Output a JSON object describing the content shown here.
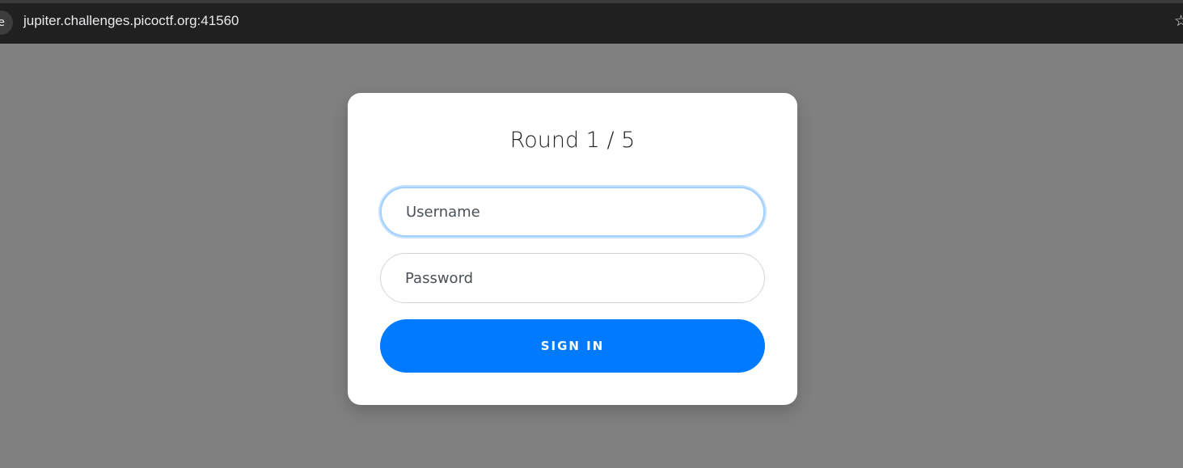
{
  "browser": {
    "site_icon": "e",
    "url": "jupiter.challenges.picoctf.org:41560",
    "bookmark_icon": "star-icon",
    "bookmark_glyph": "☆"
  },
  "login": {
    "round_title": "Round 1 / 5",
    "username_placeholder": "Username",
    "username_value": "",
    "password_placeholder": "Password",
    "password_value": "",
    "submit_label": "SIGN IN"
  },
  "colors": {
    "background": "#808080",
    "card": "#ffffff",
    "primary_button": "#007bff",
    "browser_bar": "#202020"
  }
}
